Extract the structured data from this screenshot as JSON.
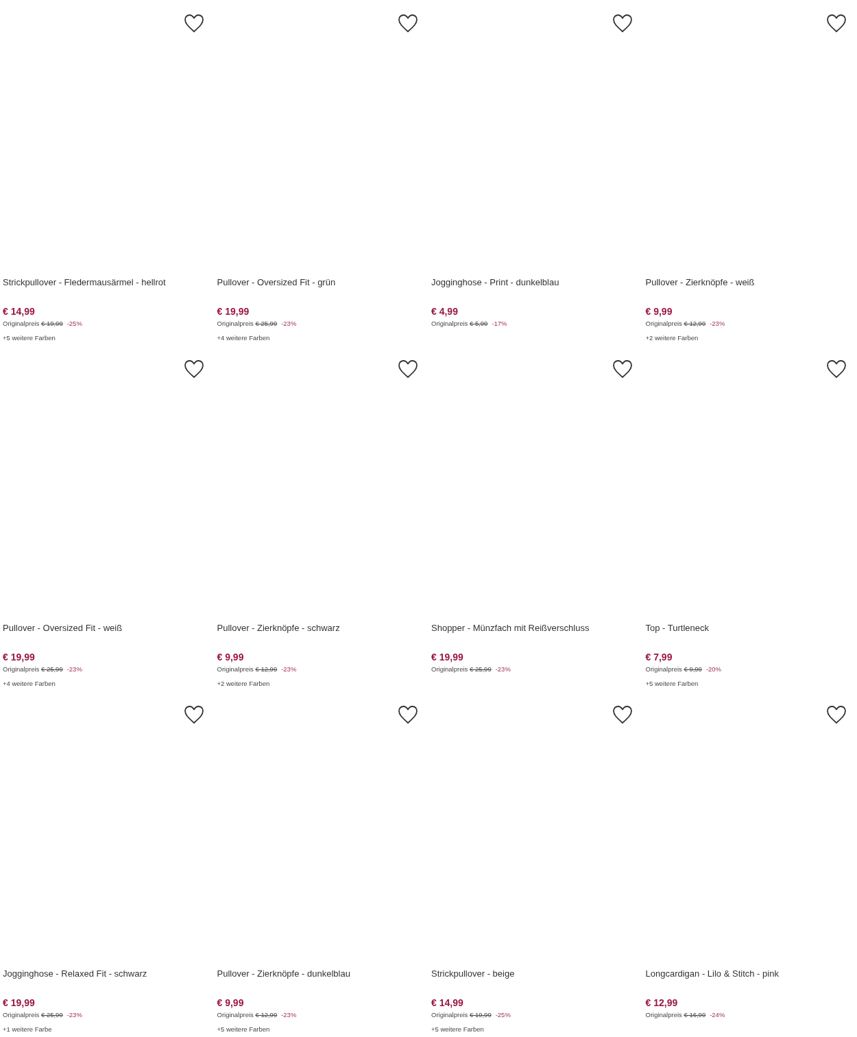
{
  "products": [
    {
      "title": "Strickpullover - Fledermausärmel - hellrot",
      "price": "€ 14,99",
      "original_label": "Originalpreis",
      "original_price": "€ 19,99",
      "discount": "-25%",
      "colors": "+5 weitere Farben"
    },
    {
      "title": "Pullover - Oversized Fit - grün",
      "price": "€ 19,99",
      "original_label": "Originalpreis",
      "original_price": "€ 25,99",
      "discount": "-23%",
      "colors": "+4 weitere Farben"
    },
    {
      "title": "Jogginghose - Print - dunkelblau",
      "price": "€ 4,99",
      "original_label": "Originalpreis",
      "original_price": "€ 5,99",
      "discount": "-17%"
    },
    {
      "title": "Pullover - Zierknöpfe - weiß",
      "price": "€ 9,99",
      "original_label": "Originalpreis",
      "original_price": "€ 12,99",
      "discount": "-23%",
      "colors": "+2 weitere Farben"
    },
    {
      "title": "Pullover - Oversized Fit - weiß",
      "price": "€ 19,99",
      "original_label": "Originalpreis",
      "original_price": "€ 25,99",
      "discount": "-23%",
      "colors": "+4 weitere Farben"
    },
    {
      "title": "Pullover - Zierknöpfe - schwarz",
      "price": "€ 9,99",
      "original_label": "Originalpreis",
      "original_price": "€ 12,99",
      "discount": "-23%",
      "colors": "+2 weitere Farben"
    },
    {
      "title": "Shopper - Münzfach mit Reißverschluss",
      "price": "€ 19,99",
      "original_label": "Originalpreis",
      "original_price": "€ 25,99",
      "discount": "-23%"
    },
    {
      "title": "Top - Turtleneck",
      "price": "€ 7,99",
      "original_label": "Originalpreis",
      "original_price": "€ 9,99",
      "discount": "-20%",
      "colors": "+5 weitere Farben"
    },
    {
      "title": "Jogginghose - Relaxed Fit - schwarz",
      "price": "€ 19,99",
      "original_label": "Originalpreis",
      "original_price": "€ 25,99",
      "discount": "-23%",
      "colors": "+1 weitere Farbe"
    },
    {
      "title": "Pullover - Zierknöpfe - dunkelblau",
      "price": "€ 9,99",
      "original_label": "Originalpreis",
      "original_price": "€ 12,99",
      "discount": "-23%",
      "colors": "+5 weitere Farben"
    },
    {
      "title": "Strickpullover - beige",
      "price": "€ 14,99",
      "original_label": "Originalpreis",
      "original_price": "€ 19,99",
      "discount": "-25%",
      "colors": "+5 weitere Farben"
    },
    {
      "title": "Longcardigan - Lilo & Stitch - pink",
      "price": "€ 12,99",
      "original_label": "Originalpreis",
      "original_price": "€ 16,99",
      "discount": "-24%"
    }
  ]
}
